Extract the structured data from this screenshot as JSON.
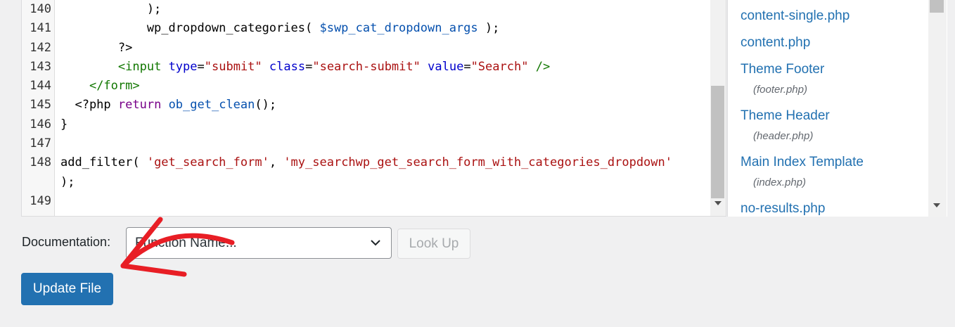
{
  "editor": {
    "lines": [
      {
        "num": "140",
        "tokens": [
          {
            "t": "            );",
            "c": "plain"
          }
        ]
      },
      {
        "num": "141",
        "tokens": [
          {
            "t": "            wp_dropdown_categories( ",
            "c": "plain"
          },
          {
            "t": "$swp_cat_dropdown_args",
            "c": "var"
          },
          {
            "t": " );",
            "c": "plain"
          }
        ]
      },
      {
        "num": "142",
        "tokens": [
          {
            "t": "        ?>",
            "c": "plain"
          }
        ]
      },
      {
        "num": "143",
        "tokens": [
          {
            "t": "        ",
            "c": "plain"
          },
          {
            "t": "<input",
            "c": "tag"
          },
          {
            "t": " ",
            "c": "plain"
          },
          {
            "t": "type",
            "c": "attr"
          },
          {
            "t": "=",
            "c": "plain"
          },
          {
            "t": "\"submit\"",
            "c": "str"
          },
          {
            "t": " ",
            "c": "plain"
          },
          {
            "t": "class",
            "c": "attr"
          },
          {
            "t": "=",
            "c": "plain"
          },
          {
            "t": "\"search-submit\"",
            "c": "str"
          },
          {
            "t": " ",
            "c": "plain"
          },
          {
            "t": "value",
            "c": "attr"
          },
          {
            "t": "=",
            "c": "plain"
          },
          {
            "t": "\"Search\"",
            "c": "str"
          },
          {
            "t": " ",
            "c": "plain"
          },
          {
            "t": "/>",
            "c": "tag"
          }
        ]
      },
      {
        "num": "144",
        "tokens": [
          {
            "t": "    ",
            "c": "plain"
          },
          {
            "t": "</form>",
            "c": "tag"
          }
        ]
      },
      {
        "num": "145",
        "tokens": [
          {
            "t": "  <?php ",
            "c": "plain"
          },
          {
            "t": "return",
            "c": "kw"
          },
          {
            "t": " ",
            "c": "plain"
          },
          {
            "t": "ob_get_clean",
            "c": "var"
          },
          {
            "t": "();",
            "c": "plain"
          }
        ]
      },
      {
        "num": "146",
        "tokens": [
          {
            "t": "}",
            "c": "plain"
          }
        ]
      },
      {
        "num": "147",
        "tokens": [
          {
            "t": "",
            "c": "plain"
          }
        ]
      },
      {
        "num": "148",
        "tokens": [
          {
            "t": "add_filter( ",
            "c": "plain"
          },
          {
            "t": "'get_search_form'",
            "c": "str"
          },
          {
            "t": ", ",
            "c": "plain"
          },
          {
            "t": "'my_searchwp_get_search_form_with_categories_dropdown'",
            "c": "str"
          },
          {
            "t": "\n);",
            "c": "plain"
          }
        ]
      },
      {
        "num": "149",
        "tokens": [
          {
            "t": "",
            "c": "plain"
          }
        ]
      }
    ]
  },
  "file_list": [
    {
      "label": "content-single.php",
      "sub": ""
    },
    {
      "label": "content.php",
      "sub": ""
    },
    {
      "label": "Theme Footer",
      "sub": "(footer.php)"
    },
    {
      "label": "Theme Header",
      "sub": "(header.php)"
    },
    {
      "label": "Main Index Template",
      "sub": "(index.php)"
    },
    {
      "label": "no-results.php",
      "sub": ""
    }
  ],
  "documentation": {
    "label": "Documentation:",
    "select_value": "Function Name...",
    "lookup_label": "Look Up"
  },
  "update_button": "Update File",
  "colors": {
    "accent": "#2271b1",
    "annotation_arrow": "#e81e25"
  }
}
